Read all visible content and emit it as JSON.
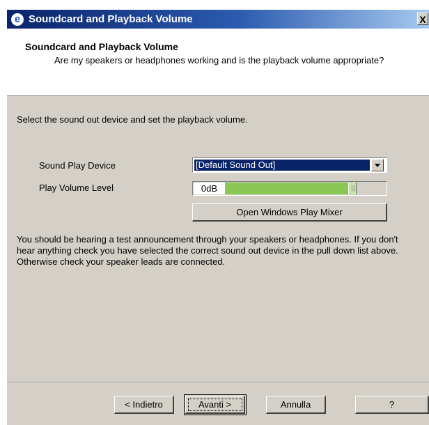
{
  "window": {
    "title": "Soundcard and Playback Volume",
    "close_label": "X"
  },
  "header": {
    "title": "Soundcard and Playback Volume",
    "subtitle": "Are my speakers or headphones working and is the playback volume appropriate?"
  },
  "main": {
    "instruction": "Select the sound out device and set the playback volume.",
    "device_label": "Sound Play Device",
    "device_value": "[Default Sound Out]",
    "volume_label": "Play Volume Level",
    "volume_value": "0dB",
    "volume_fraction": 0.78,
    "mixer_button": "Open Windows Play Mixer",
    "info_text": "You should be hearing a test announcement through your speakers or headphones. If you don't hear anything check you have selected the correct sound out device in the pull down list above. Otherwise check your speaker leads are connected."
  },
  "footer": {
    "back_label": "< Indietro",
    "next_label": "Avanti >",
    "cancel_label": "Annulla",
    "help_label": "?"
  },
  "colors": {
    "titlebar_start": "#0a246a",
    "dialog_bg": "#d4d0c8",
    "selection_bg": "#0a246a",
    "volume_fill": "#8ac653"
  },
  "icons": {
    "title_icon": "e-app-icon",
    "close_icon": "close-icon",
    "dropdown_icon": "chevron-down-icon"
  }
}
